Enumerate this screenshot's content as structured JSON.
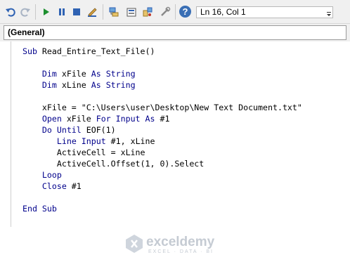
{
  "toolbar": {
    "position_text": "Ln 16, Col 1",
    "help_glyph": "?",
    "icons": [
      "undo-icon",
      "redo-icon",
      "run-icon",
      "break-icon",
      "reset-icon",
      "design-mode-icon",
      "project-explorer-icon",
      "properties-icon",
      "object-browser-icon",
      "toolbox-icon",
      "help-icon"
    ]
  },
  "procedure_combo": {
    "value": "(General)"
  },
  "code_lines": [
    [
      {
        "t": "Sub",
        "k": 1
      },
      {
        "t": " Read_Entire_Text_File()",
        "k": 0
      }
    ],
    [],
    [
      {
        "t": "    ",
        "k": 0
      },
      {
        "t": "Dim",
        "k": 1
      },
      {
        "t": " xFile ",
        "k": 0
      },
      {
        "t": "As String",
        "k": 1
      }
    ],
    [
      {
        "t": "    ",
        "k": 0
      },
      {
        "t": "Dim",
        "k": 1
      },
      {
        "t": " xLine ",
        "k": 0
      },
      {
        "t": "As String",
        "k": 1
      }
    ],
    [],
    [
      {
        "t": "    xFile = \"C:\\Users\\user\\Desktop\\New Text Document.txt\"",
        "k": 0
      }
    ],
    [
      {
        "t": "    ",
        "k": 0
      },
      {
        "t": "Open",
        "k": 1
      },
      {
        "t": " xFile ",
        "k": 0
      },
      {
        "t": "For Input As",
        "k": 1
      },
      {
        "t": " #1",
        "k": 0
      }
    ],
    [
      {
        "t": "    ",
        "k": 0
      },
      {
        "t": "Do Until",
        "k": 1
      },
      {
        "t": " EOF(1)",
        "k": 0
      }
    ],
    [
      {
        "t": "       ",
        "k": 0
      },
      {
        "t": "Line Input",
        "k": 1
      },
      {
        "t": " #1, xLine",
        "k": 0
      }
    ],
    [
      {
        "t": "       ActiveCell = xLine",
        "k": 0
      }
    ],
    [
      {
        "t": "       ActiveCell.Offset(1, 0).Select",
        "k": 0
      }
    ],
    [
      {
        "t": "    ",
        "k": 0
      },
      {
        "t": "Loop",
        "k": 1
      }
    ],
    [
      {
        "t": "    ",
        "k": 0
      },
      {
        "t": "Close",
        "k": 1
      },
      {
        "t": " #1",
        "k": 0
      }
    ],
    [],
    [
      {
        "t": "End Sub",
        "k": 1
      }
    ]
  ],
  "watermark": {
    "brand": "exceldemy",
    "tagline": "EXCEL · DATA · BI"
  }
}
